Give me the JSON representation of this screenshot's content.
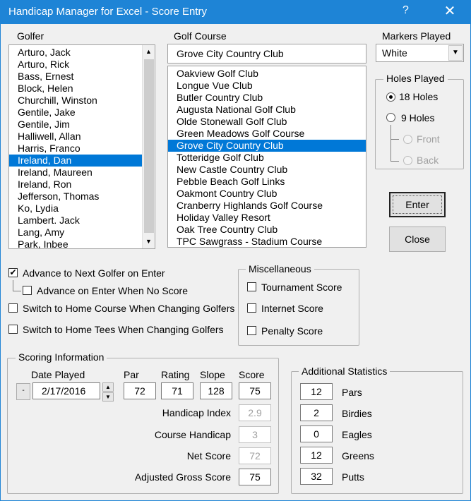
{
  "window": {
    "title": "Handicap Manager for Excel - Score Entry",
    "help": "?",
    "close": "✕"
  },
  "golfer": {
    "label": "Golfer",
    "items": [
      "Arturo, Jack",
      "Arturo, Rick",
      "Bass, Ernest",
      "Block, Helen",
      "Churchill, Winston",
      "Gentile, Jake",
      "Gentile, Jim",
      "Halliwell, Allan",
      "Harris, Franco",
      "Ireland, Dan",
      "Ireland, Maureen",
      "Ireland, Ron",
      "Jefferson, Thomas",
      "Ko, Lydia",
      "Lambert. Jack",
      "Lang, Amy",
      "Park, Inbee"
    ],
    "selected_index": 9
  },
  "course": {
    "label": "Golf Course",
    "current": "Grove City Country Club",
    "items": [
      "Oakview Golf Club",
      "Longue Vue Club",
      "Butler Country Club",
      "Augusta National Golf Club",
      "Olde Stonewall Golf Club",
      "Green Meadows Golf Course",
      "Grove City Country Club",
      "Totteridge Golf Club",
      "New Castle Country Club",
      "Pebble Beach Golf Links",
      "Oakmont Country Club",
      "Cranberry Highlands Golf Course",
      "Holiday Valley Resort",
      "Oak Tree Country Club",
      "TPC Sawgrass - Stadium Course"
    ],
    "selected_index": 6
  },
  "markers": {
    "label": "Markers Played",
    "value": "White"
  },
  "holes": {
    "title": "Holes Played",
    "h18": "18 Holes",
    "h9": "9 Holes",
    "front": "Front",
    "back": "Back",
    "selected": "18"
  },
  "buttons": {
    "enter": "Enter",
    "close": "Close"
  },
  "options": {
    "advance_next": "Advance to Next Golfer on Enter",
    "advance_no_score": "Advance on Enter When No Score",
    "switch_course": "Switch to Home Course When Changing Golfers",
    "switch_tees": "Switch to Home Tees When Changing Golfers",
    "advance_next_checked": true
  },
  "misc": {
    "title": "Miscellaneous",
    "tournament": "Tournament Score",
    "internet": "Internet Score",
    "penalty": "Penalty Score"
  },
  "scoring": {
    "title": "Scoring Information",
    "date_label": "Date Played",
    "date_value": "2/17/2016",
    "minus": "-",
    "par_label": "Par",
    "par": "72",
    "rating_label": "Rating",
    "rating": "71",
    "slope_label": "Slope",
    "slope": "128",
    "score_label": "Score",
    "score": "75",
    "hcp_index_label": "Handicap Index",
    "hcp_index": "2.9",
    "course_hcp_label": "Course Handicap",
    "course_hcp": "3",
    "net_label": "Net Score",
    "net": "72",
    "adj_label": "Adjusted Gross Score",
    "adj": "75"
  },
  "stats": {
    "title": "Additional Statistics",
    "pars_label": "Pars",
    "pars": "12",
    "birdies_label": "Birdies",
    "birdies": "2",
    "eagles_label": "Eagles",
    "eagles": "0",
    "greens_label": "Greens",
    "greens": "12",
    "putts_label": "Putts",
    "putts": "32"
  },
  "icons": {
    "up": "▲",
    "down": "▼",
    "check": "✔"
  }
}
